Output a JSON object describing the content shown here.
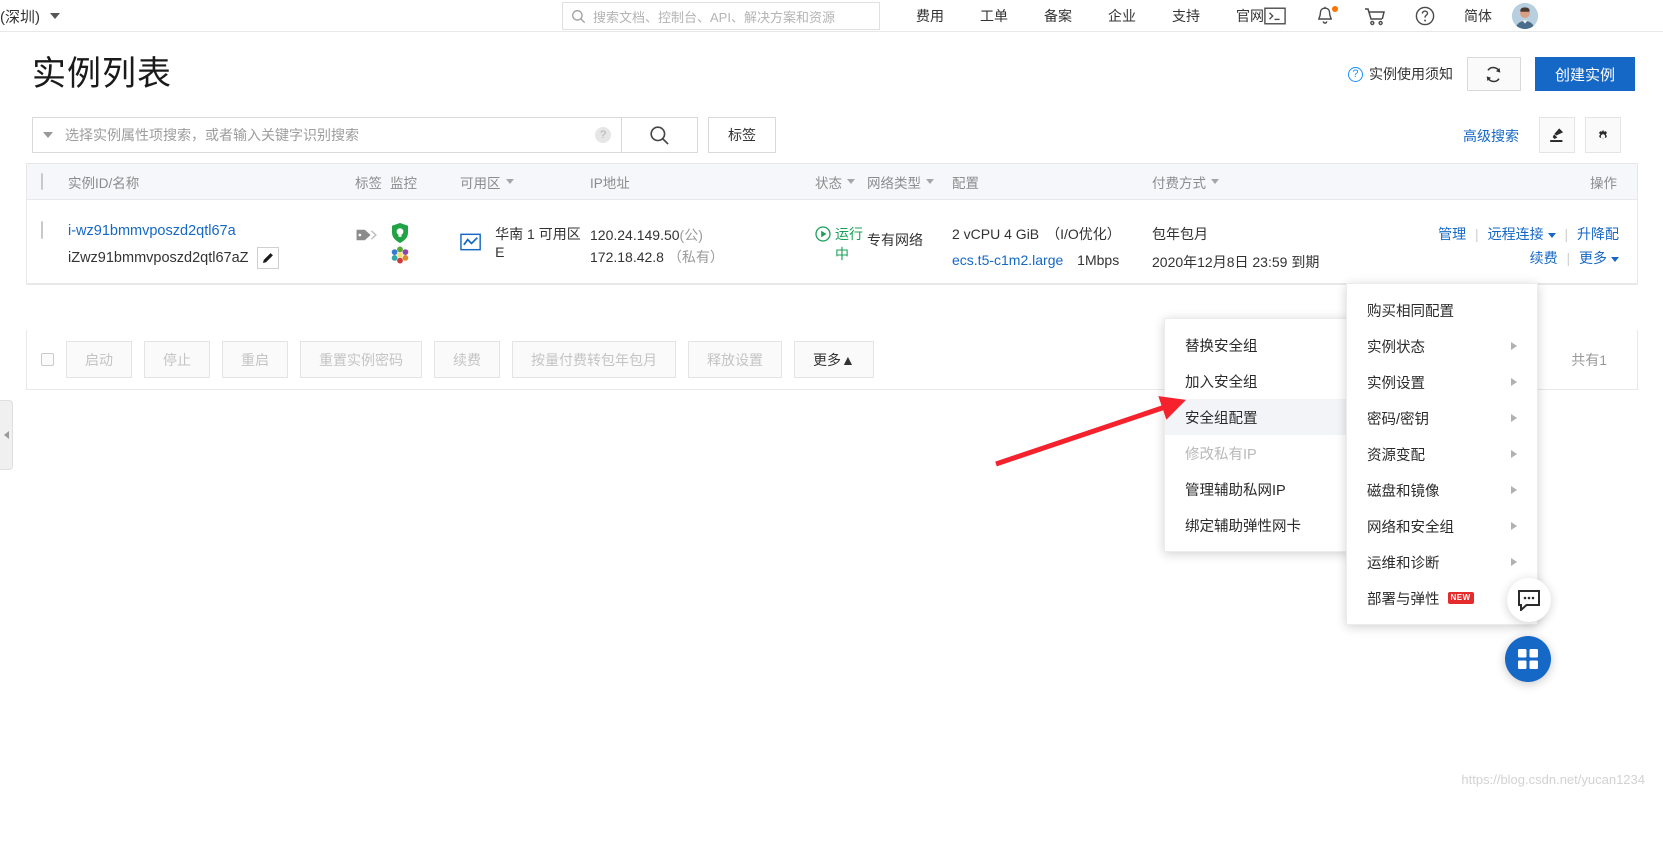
{
  "topnav": {
    "region": "(深圳)",
    "search_placeholder": "搜索文档、控制台、API、解决方案和资源",
    "links": [
      "费用",
      "工单",
      "备案",
      "企业",
      "支持",
      "官网"
    ],
    "icons": [
      "terminal-icon",
      "bell-icon",
      "cart-icon",
      "help-icon"
    ],
    "lang": "简体"
  },
  "header": {
    "title": "实例列表",
    "notice": "实例使用须知",
    "refresh": "refresh-icon",
    "create": "创建实例"
  },
  "search": {
    "placeholder": "选择实例属性项搜索，或者输入关键字识别搜索",
    "tag_button": "标签",
    "advanced": "高级搜索"
  },
  "table": {
    "columns": [
      {
        "label": "实例ID/名称",
        "sortable": false
      },
      {
        "label": "标签",
        "sortable": false
      },
      {
        "label": "监控",
        "sortable": false
      },
      {
        "label": "可用区",
        "sortable": true
      },
      {
        "label": "IP地址",
        "sortable": false
      },
      {
        "label": "状态",
        "sortable": true
      },
      {
        "label": "网络类型",
        "sortable": true
      },
      {
        "label": "配置",
        "sortable": false
      },
      {
        "label": "付费方式",
        "sortable": true
      },
      {
        "label": "操作",
        "sortable": false
      }
    ],
    "rows": [
      {
        "instance_id": "i-wz91bmmvposzd2qtl67a",
        "instance_name": "iZwz91bmmvposzd2qtl67aZ",
        "zone": "华南 1 可用区 E",
        "ip_public": "120.24.149.50",
        "ip_public_label": "(公)",
        "ip_private": "172.18.42.8",
        "ip_private_label": "（私有）",
        "status": "运行中",
        "network_type": "专有网络",
        "config_line1": "2 vCPU 4 GiB　（I/O优化）",
        "config_type": "ecs.t5-c1m2.large",
        "config_bandwidth": "1Mbps",
        "pay_type": "包年包月",
        "pay_expire": "2020年12月8日 23:59 到期",
        "ops": {
          "manage": "管理",
          "remote": "远程连接",
          "upgrade": "升降配",
          "renew": "续费",
          "more": "更多"
        }
      }
    ]
  },
  "toolbar": {
    "buttons": [
      {
        "label": "启动",
        "enabled": false
      },
      {
        "label": "停止",
        "enabled": false
      },
      {
        "label": "重启",
        "enabled": false
      },
      {
        "label": "重置实例密码",
        "enabled": false
      },
      {
        "label": "续费",
        "enabled": false
      },
      {
        "label": "按量付费转包年包月",
        "enabled": false
      },
      {
        "label": "释放设置",
        "enabled": false
      },
      {
        "label": "更多▲",
        "enabled": true
      }
    ],
    "total": "共有1"
  },
  "menu_security_group": {
    "items": [
      {
        "label": "替换安全组",
        "disabled": false,
        "active": false,
        "submenu": false
      },
      {
        "label": "加入安全组",
        "disabled": false,
        "active": false,
        "submenu": false
      },
      {
        "label": "安全组配置",
        "disabled": false,
        "active": true,
        "submenu": false
      },
      {
        "label": "修改私有IP",
        "disabled": true,
        "active": false,
        "submenu": false
      },
      {
        "label": "管理辅助私网IP",
        "disabled": false,
        "active": false,
        "submenu": false
      },
      {
        "label": "绑定辅助弹性网卡",
        "disabled": false,
        "active": false,
        "submenu": false
      }
    ]
  },
  "menu_more": {
    "items": [
      {
        "label": "购买相同配置",
        "submenu": false,
        "badge": ""
      },
      {
        "label": "实例状态",
        "submenu": true,
        "badge": ""
      },
      {
        "label": "实例设置",
        "submenu": true,
        "badge": ""
      },
      {
        "label": "密码/密钥",
        "submenu": true,
        "badge": ""
      },
      {
        "label": "资源变配",
        "submenu": true,
        "badge": ""
      },
      {
        "label": "磁盘和镜像",
        "submenu": true,
        "badge": ""
      },
      {
        "label": "网络和安全组",
        "submenu": true,
        "badge": ""
      },
      {
        "label": "运维和诊断",
        "submenu": true,
        "badge": ""
      },
      {
        "label": "部署与弹性",
        "submenu": false,
        "badge": "NEW"
      }
    ]
  },
  "watermark": "https://blog.csdn.net/yucan1234",
  "colors": {
    "accent": "#1668c6",
    "running": "#18a058",
    "annotation_arrow": "#f5222d",
    "new_badge": "#e52b2b"
  }
}
